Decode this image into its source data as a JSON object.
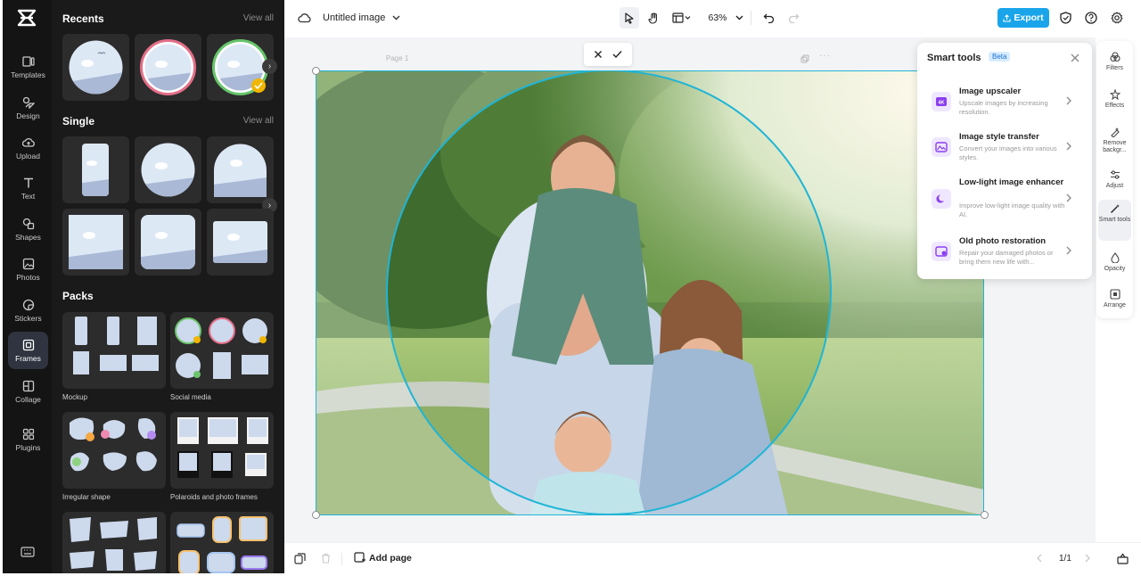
{
  "app": {
    "logo": "capcut-logo"
  },
  "rail": {
    "items": [
      {
        "label": "Templates",
        "icon": "templates-icon"
      },
      {
        "label": "Design",
        "icon": "design-icon"
      },
      {
        "label": "Upload",
        "icon": "upload-icon"
      },
      {
        "label": "Text",
        "icon": "text-icon"
      },
      {
        "label": "Shapes",
        "icon": "shapes-icon"
      },
      {
        "label": "Photos",
        "icon": "photos-icon"
      },
      {
        "label": "Stickers",
        "icon": "stickers-icon"
      },
      {
        "label": "Frames",
        "icon": "frames-icon",
        "active": true
      },
      {
        "label": "Collage",
        "icon": "collage-icon"
      },
      {
        "label": "Plugins",
        "icon": "plugins-icon"
      }
    ]
  },
  "panel": {
    "recents_title": "Recents",
    "recents_view_all": "View all",
    "single_title": "Single",
    "single_view_all": "View all",
    "packs_title": "Packs",
    "packs": [
      {
        "label": "Mockup"
      },
      {
        "label": "Social media"
      },
      {
        "label": "Irregular shape"
      },
      {
        "label": "Polaroids and photo frames"
      }
    ]
  },
  "topbar": {
    "doc_title": "Untitled image",
    "zoom": "63%",
    "export_label": "Export"
  },
  "canvas": {
    "page_label": "Page 1"
  },
  "smart_tools": {
    "title": "Smart tools",
    "badge": "Beta",
    "tools": [
      {
        "name": "Image upscaler",
        "desc": "Upscale images by increasing resolution."
      },
      {
        "name": "Image style transfer",
        "desc": "Convert your images into various styles."
      },
      {
        "name": "Low-light image enhancer",
        "desc": "Improve low-light image quality with AI."
      },
      {
        "name": "Old photo restoration",
        "desc": "Repair your damaged photos or bring them new life with..."
      }
    ]
  },
  "right_rail": {
    "items": [
      {
        "label": "Filters"
      },
      {
        "label": "Effects"
      },
      {
        "label": "Remove backgr..."
      },
      {
        "label": "Adjust"
      },
      {
        "label": "Smart tools",
        "active": true
      },
      {
        "label": "Opacity"
      },
      {
        "label": "Arrange"
      }
    ]
  },
  "bottombar": {
    "add_page_label": "Add page",
    "page_count": "1/1"
  },
  "colors": {
    "accent": "#1aa5ea",
    "selection": "#1fb5d6",
    "rail_bg": "#141414",
    "panel_bg": "#1a1a1a"
  }
}
